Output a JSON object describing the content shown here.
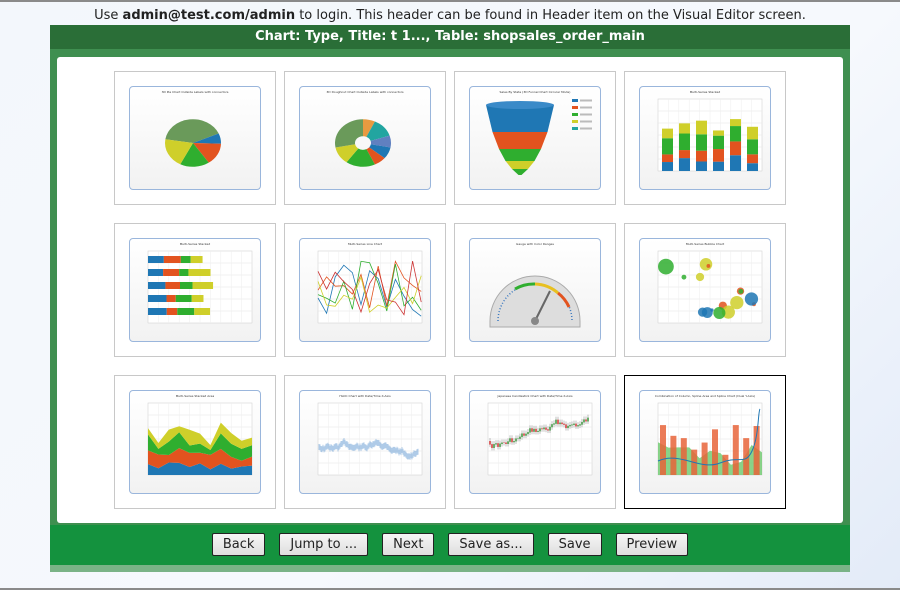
{
  "header": {
    "prefix": "Use ",
    "credentials": "admin@test.com/admin",
    "suffix": " to login. This header can be found in Header item on the Visual Editor screen."
  },
  "panel_title": "Chart: Type, Title: t 1..., Table: shopsales_order_main",
  "thumbnails": [
    {
      "type": "pie3d",
      "title": "3D Pie Chart Outside Labels with connectors",
      "selected": false
    },
    {
      "type": "doughnut3d",
      "title": "3D Doughnut Chart Outside Labels with connectors",
      "selected": false
    },
    {
      "type": "funnel",
      "title": "Sales By State (3D Funnel Chart Circular Mode)",
      "selected": false
    },
    {
      "type": "stacked-column",
      "title": "Multi-Series Stacked",
      "selected": false
    },
    {
      "type": "stacked-bar",
      "title": "Multi-Series Stacked",
      "selected": false
    },
    {
      "type": "line",
      "title": "Multi-Series Line Chart",
      "selected": false
    },
    {
      "type": "gauge",
      "title": "Gauge with Color Ranges",
      "selected": false
    },
    {
      "type": "bubble",
      "title": "Multi-Series Bubble Chart",
      "selected": false
    },
    {
      "type": "stacked-area",
      "title": "Multi-Series Stacked Area",
      "selected": false
    },
    {
      "type": "hloc",
      "title": "HLOC Chart with Date/Time X-Axis",
      "selected": false
    },
    {
      "type": "candlestick",
      "title": "Japanese Candlestick Chart with Date/Time X-Axis",
      "selected": false
    },
    {
      "type": "combination",
      "title": "Combination of Column, Spline Area and Spline Chart (Dual Y-Axis)",
      "selected": true
    }
  ],
  "buttons": {
    "back": "Back",
    "jump": "Jump to ...",
    "next": "Next",
    "save_as": "Save as...",
    "save": "Save",
    "preview": "Preview"
  },
  "colors": {
    "title_bar": "#2a6e37",
    "button_bar": "#14923e",
    "panel": "#3f8f50"
  }
}
